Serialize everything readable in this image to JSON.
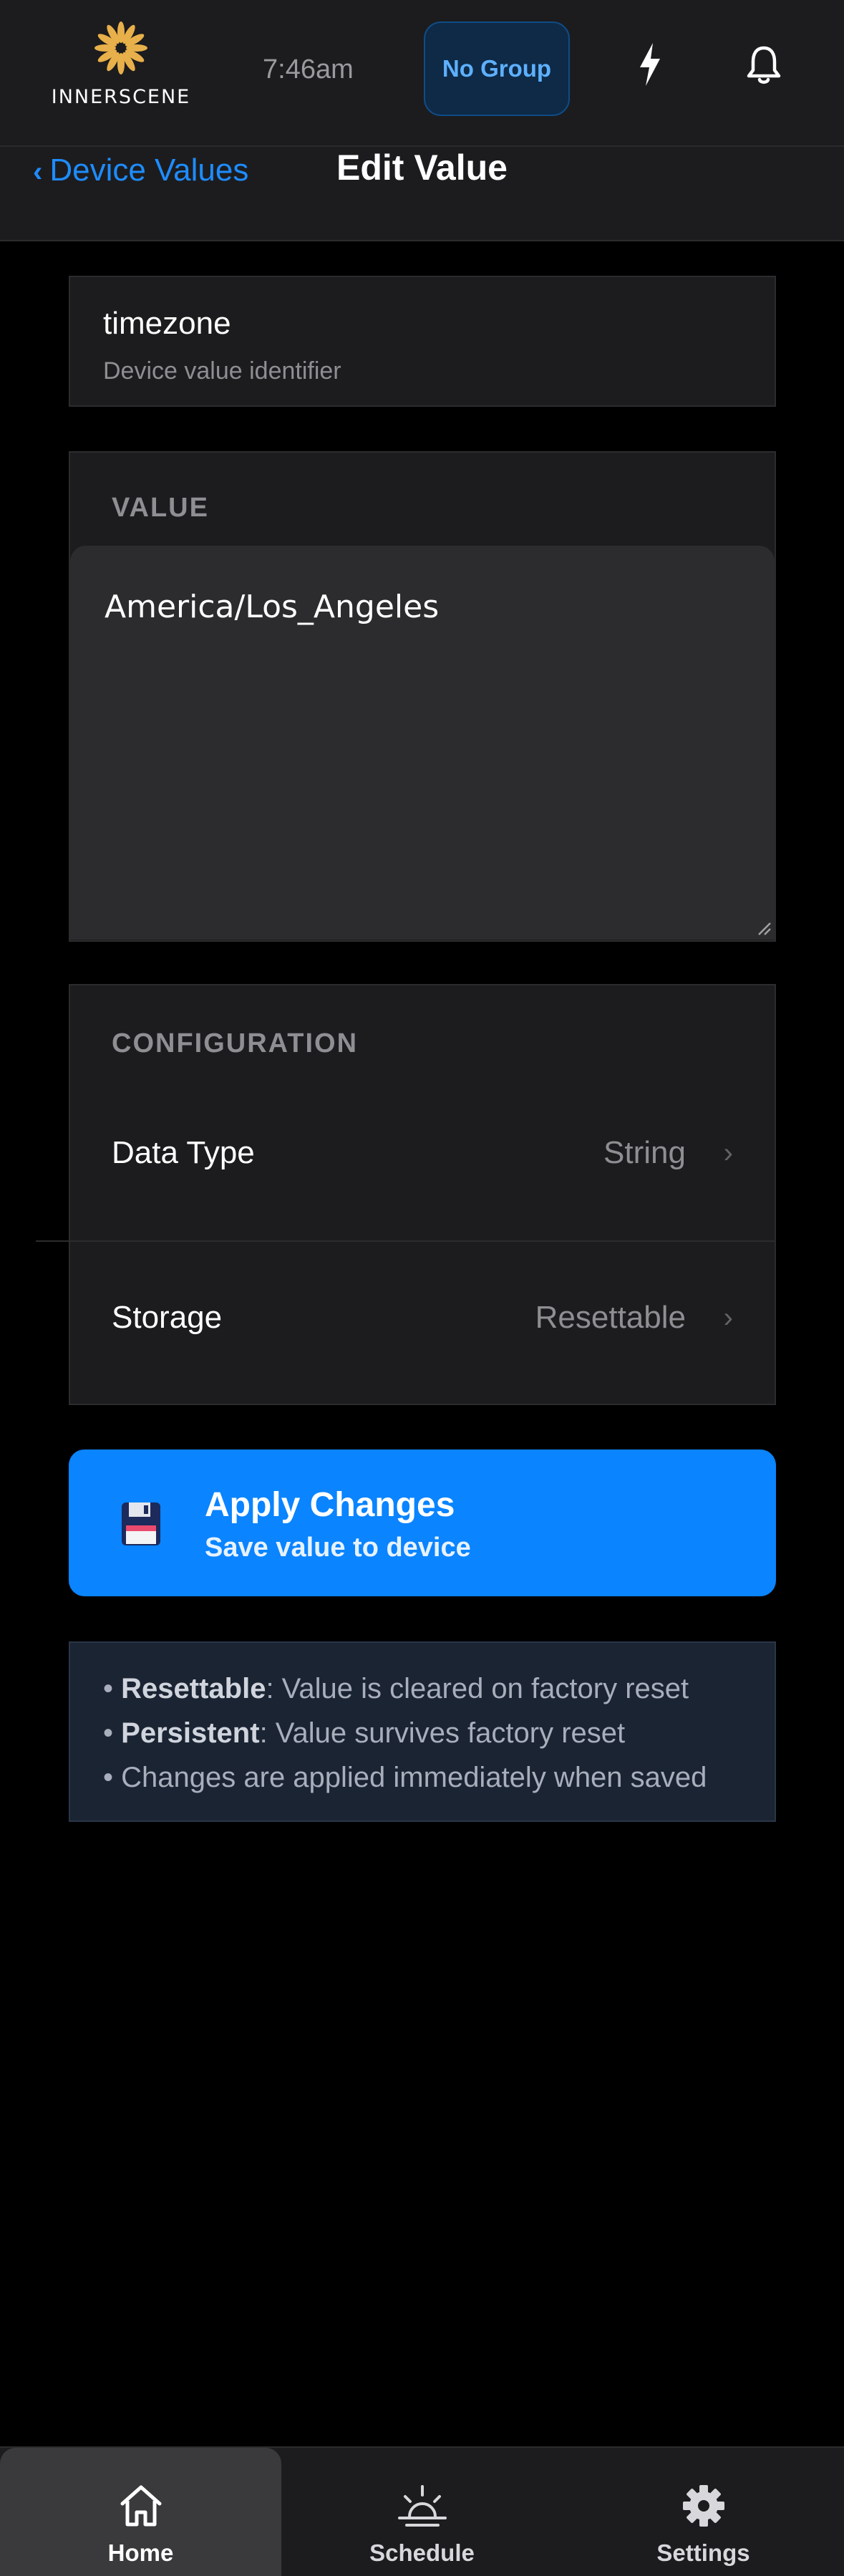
{
  "header": {
    "logo_text": "INNERSCENE",
    "time": "7:46am",
    "group_label": "No Group"
  },
  "nav": {
    "back_label": "Device Values",
    "title": "Edit Value"
  },
  "identifier": {
    "name": "timezone",
    "subtitle": "Device value identifier"
  },
  "value_section": {
    "label": "VALUE",
    "value": "America/Los_Angeles"
  },
  "configuration": {
    "label": "CONFIGURATION",
    "rows": [
      {
        "label": "Data Type",
        "value": "String"
      },
      {
        "label": "Storage",
        "value": "Resettable"
      }
    ]
  },
  "apply": {
    "title": "Apply Changes",
    "subtitle": "Save value to device"
  },
  "info": {
    "line1_bold": "Resettable",
    "line1_rest": ": Value is cleared on factory reset",
    "line2_bold": "Persistent",
    "line2_rest": ": Value survives factory reset",
    "line3": "Changes are applied immediately when saved",
    "bullet": "•"
  },
  "tabs": [
    {
      "label": "Home",
      "icon": "home-icon"
    },
    {
      "label": "Schedule",
      "icon": "sunrise-icon"
    },
    {
      "label": "Settings",
      "icon": "gear-icon"
    }
  ],
  "colors": {
    "accent": "#0a84ff",
    "logo_gold": "#e8b04a"
  }
}
